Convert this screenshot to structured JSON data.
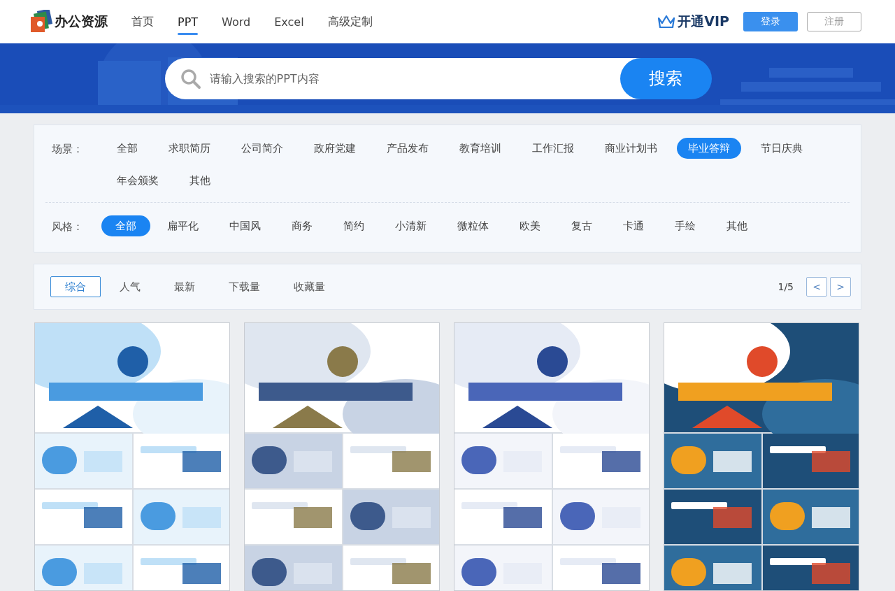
{
  "header": {
    "logo": "办公资源",
    "nav": [
      {
        "label": "首页",
        "selected": false
      },
      {
        "label": "PPT",
        "selected": true
      },
      {
        "label": "Word",
        "selected": false
      },
      {
        "label": "Excel",
        "selected": false
      },
      {
        "label": "高级定制",
        "selected": false
      }
    ],
    "vip": "开通VIP",
    "login": "登录",
    "register": "注册"
  },
  "search": {
    "placeholder": "请输入搜索的PPT内容",
    "button": "搜索"
  },
  "filters": [
    {
      "label": "场景：",
      "kind": "scene",
      "items": [
        {
          "label": "全部",
          "selected": false
        },
        {
          "label": "求职简历",
          "selected": false
        },
        {
          "label": "公司简介",
          "selected": false
        },
        {
          "label": "政府党建",
          "selected": false
        },
        {
          "label": "产品发布",
          "selected": false
        },
        {
          "label": "教育培训",
          "selected": false
        },
        {
          "label": "工作汇报",
          "selected": false
        },
        {
          "label": "商业计划书",
          "selected": false
        },
        {
          "label": "毕业答辩",
          "selected": true
        },
        {
          "label": "节日庆典",
          "selected": false
        },
        {
          "label": "年会颁奖",
          "selected": false
        },
        {
          "label": "其他",
          "selected": false
        }
      ]
    },
    {
      "label": "风格：",
      "kind": "style",
      "items": [
        {
          "label": "全部",
          "selected": true
        },
        {
          "label": "扁平化",
          "selected": false
        },
        {
          "label": "中国风",
          "selected": false
        },
        {
          "label": "商务",
          "selected": false
        },
        {
          "label": "简约",
          "selected": false
        },
        {
          "label": "小清新",
          "selected": false
        },
        {
          "label": "微粒体",
          "selected": false
        },
        {
          "label": "欧美",
          "selected": false
        },
        {
          "label": "复古",
          "selected": false
        },
        {
          "label": "卡通",
          "selected": false
        },
        {
          "label": "手绘",
          "selected": false
        },
        {
          "label": "其他",
          "selected": false
        }
      ]
    }
  ],
  "sort": {
    "tabs": [
      {
        "label": "综合",
        "selected": true
      },
      {
        "label": "人气",
        "selected": false
      },
      {
        "label": "最新",
        "selected": false
      },
      {
        "label": "下载量",
        "selected": false
      },
      {
        "label": "收藏量",
        "selected": false
      }
    ],
    "page": "1/5",
    "prev": "<",
    "next": ">"
  }
}
